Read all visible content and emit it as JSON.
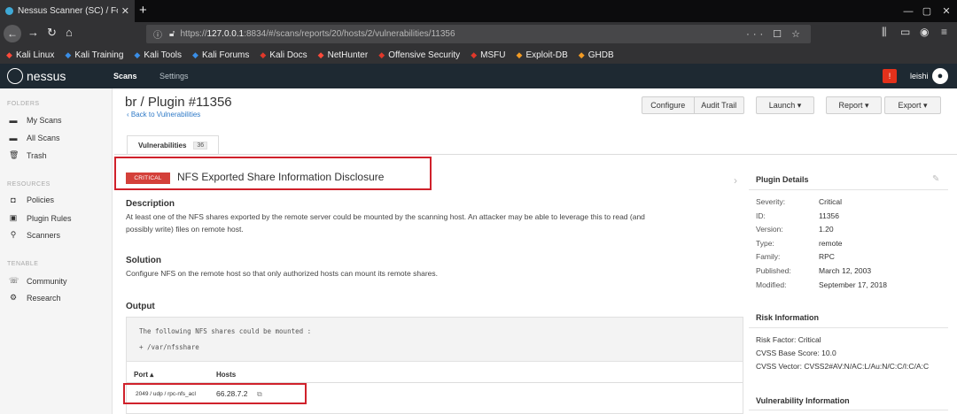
{
  "browser": {
    "tab_title": "Nessus Scanner (SC) / Fo",
    "tab_close": "✕",
    "new_tab": "+",
    "url_prefix": "https://",
    "url_host": "127.0.0.1",
    "url_rest": ":8834/#/scans/reports/20/hosts/2/vulnerabilities/11356",
    "url_actions": "··· ☐ ☆",
    "bookmarks": [
      {
        "label": "Kali Linux",
        "icon": "kali-dragon-icon",
        "color": "#ff4a3a"
      },
      {
        "label": "Kali Training",
        "icon": "kali-k-icon",
        "color": "#3a8ee6"
      },
      {
        "label": "Kali Tools",
        "icon": "kali-k-icon",
        "color": "#3a8ee6"
      },
      {
        "label": "Kali Forums",
        "icon": "kali-k-icon",
        "color": "#3a8ee6"
      },
      {
        "label": "Kali Docs",
        "icon": "kali-docs-icon",
        "color": "#e0382a"
      },
      {
        "label": "NetHunter",
        "icon": "kali-dragon-icon",
        "color": "#ff4a3a"
      },
      {
        "label": "Offensive Security",
        "icon": "offsec-icon",
        "color": "#e0382a"
      },
      {
        "label": "MSFU",
        "icon": "offsec-icon",
        "color": "#e0382a"
      },
      {
        "label": "Exploit-DB",
        "icon": "exploitdb-icon",
        "color": "#f29b24"
      },
      {
        "label": "GHDB",
        "icon": "exploitdb-icon",
        "color": "#f29b24"
      }
    ]
  },
  "app": {
    "logo": "nessus",
    "nav": {
      "scans": "Scans",
      "settings": "Settings"
    },
    "bell": "!",
    "username": "leishi",
    "avatar": "●"
  },
  "sidebar": {
    "folders_label": "FOLDERS",
    "folders": [
      {
        "label": "My Scans",
        "icon": "folder-icon"
      },
      {
        "label": "All Scans",
        "icon": "folder-icon"
      },
      {
        "label": "Trash",
        "icon": "trash-icon"
      }
    ],
    "resources_label": "RESOURCES",
    "resources": [
      {
        "label": "Policies",
        "icon": "policy-icon"
      },
      {
        "label": "Plugin Rules",
        "icon": "plugin-rules-icon"
      },
      {
        "label": "Scanners",
        "icon": "scanner-icon"
      }
    ],
    "tenable_label": "TENABLE",
    "tenable": [
      {
        "label": "Community",
        "icon": "community-icon"
      },
      {
        "label": "Research",
        "icon": "research-icon"
      }
    ]
  },
  "header": {
    "title": "br / Plugin #11356",
    "back_link": "‹ Back to Vulnerabilities",
    "buttons": {
      "configure": "Configure",
      "audit_trail": "Audit Trail",
      "launch": "Launch ▾",
      "report": "Report ▾",
      "export": "Export ▾"
    }
  },
  "tabs": {
    "vulnerabilities": "Vulnerabilities",
    "count": "36"
  },
  "vuln": {
    "severity_badge": "CRITICAL",
    "severity_color": "#d4403a",
    "title": "NFS Exported Share Information Disclosure",
    "description_heading": "Description",
    "description_line1": "At least one of the NFS shares exported by the remote server could be mounted by the scanning host. An attacker may be able to leverage this to read (and",
    "description_line2": "possibly write) files on remote host.",
    "solution_heading": "Solution",
    "solution_text": "Configure NFS on the remote host so that only authorized hosts can mount its remote shares.",
    "output_heading": "Output",
    "output_line1": "The following NFS shares could be mounted :",
    "output_line2": "+ /var/nfsshare",
    "table": {
      "col_port": "Port ▴",
      "col_hosts": "Hosts",
      "rows": [
        {
          "port": "2049 / udp / rpc-nfs_acl",
          "host": "66.28.7.2",
          "ext": "⧉"
        }
      ]
    }
  },
  "plugin_details": {
    "heading": "Plugin Details",
    "edit": "✎",
    "fields": [
      {
        "key": "Severity:",
        "value": "Critical"
      },
      {
        "key": "ID:",
        "value": "11356"
      },
      {
        "key": "Version:",
        "value": "1.20"
      },
      {
        "key": "Type:",
        "value": "remote"
      },
      {
        "key": "Family:",
        "value": "RPC"
      },
      {
        "key": "Published:",
        "value": "March 12, 2003"
      },
      {
        "key": "Modified:",
        "value": "September 17, 2018"
      }
    ]
  },
  "risk_info": {
    "heading": "Risk Information",
    "risk_factor": "Risk Factor: Critical",
    "cvss_base": "CVSS Base Score: 10.0",
    "cvss_vector": "CVSS Vector: CVSS2#AV:N/AC:L/Au:N/C:C/I:C/A:C"
  },
  "vuln_info": {
    "heading": "Vulnerability Information"
  },
  "colors": {
    "link": "#2f7ac7",
    "highlight_box": "#d0212b",
    "nav_bg": "#1e2932"
  }
}
